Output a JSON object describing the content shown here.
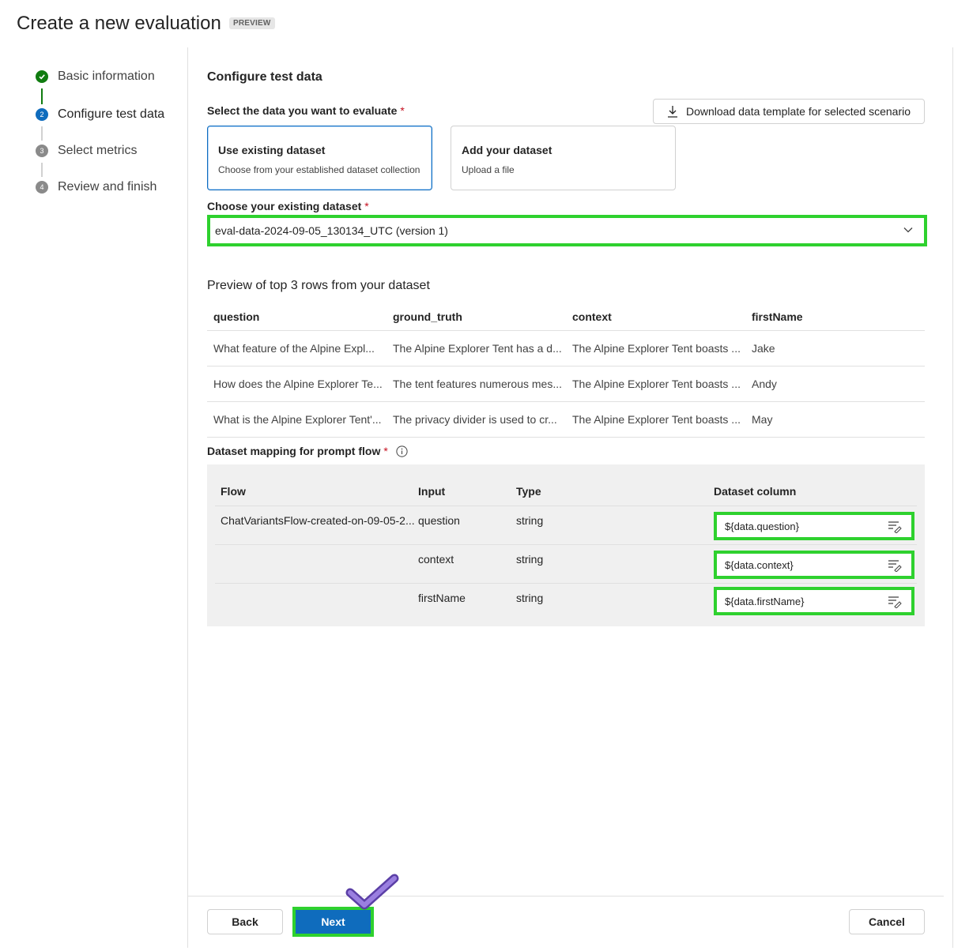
{
  "header": {
    "title": "Create a new evaluation",
    "badge": "PREVIEW"
  },
  "steps": [
    {
      "number": "1",
      "label": "Basic information",
      "state": "done"
    },
    {
      "number": "2",
      "label": "Configure test data",
      "state": "current"
    },
    {
      "number": "3",
      "label": "Select metrics",
      "state": "todo"
    },
    {
      "number": "4",
      "label": "Review and finish",
      "state": "todo"
    }
  ],
  "section": {
    "title": "Configure test data",
    "select_label": "Select the data you want to evaluate",
    "required_mark": "*",
    "download_label": "Download data template for selected scenario"
  },
  "cards": [
    {
      "title": "Use existing dataset",
      "desc": "Choose from your established dataset collection",
      "selected": true
    },
    {
      "title": "Add your dataset",
      "desc": "Upload a file",
      "selected": false
    }
  ],
  "dataset": {
    "label": "Choose your existing dataset",
    "value": "eval-data-2024-09-05_130134_UTC (version 1)"
  },
  "preview": {
    "title": "Preview of top 3 rows from your dataset",
    "columns": [
      "question",
      "ground_truth",
      "context",
      "firstName"
    ],
    "rows": [
      [
        "What feature of the Alpine Expl...",
        "The Alpine Explorer Tent has a d...",
        "The Alpine Explorer Tent boasts ...",
        "Jake"
      ],
      [
        "How does the Alpine Explorer Te...",
        "The tent features numerous mes...",
        "The Alpine Explorer Tent boasts ...",
        "Andy"
      ],
      [
        "What is the Alpine Explorer Tent'...",
        "The privacy divider is used to cr...",
        "The Alpine Explorer Tent boasts ...",
        "May"
      ]
    ]
  },
  "mapping": {
    "label": "Dataset mapping for prompt flow",
    "headers": {
      "flow": "Flow",
      "input": "Input",
      "type": "Type",
      "column": "Dataset column"
    },
    "flow_name": "ChatVariantsFlow-created-on-09-05-2...",
    "rows": [
      {
        "input": "question",
        "type": "string",
        "column": "${data.question}"
      },
      {
        "input": "context",
        "type": "string",
        "column": "${data.context}"
      },
      {
        "input": "firstName",
        "type": "string",
        "column": "${data.firstName}"
      }
    ]
  },
  "footer": {
    "back": "Back",
    "next": "Next",
    "cancel": "Cancel"
  },
  "colors": {
    "accent": "#0f6cbd",
    "success": "#107c10",
    "highlight": "#2ed12e",
    "check": "#7b5cc9"
  }
}
